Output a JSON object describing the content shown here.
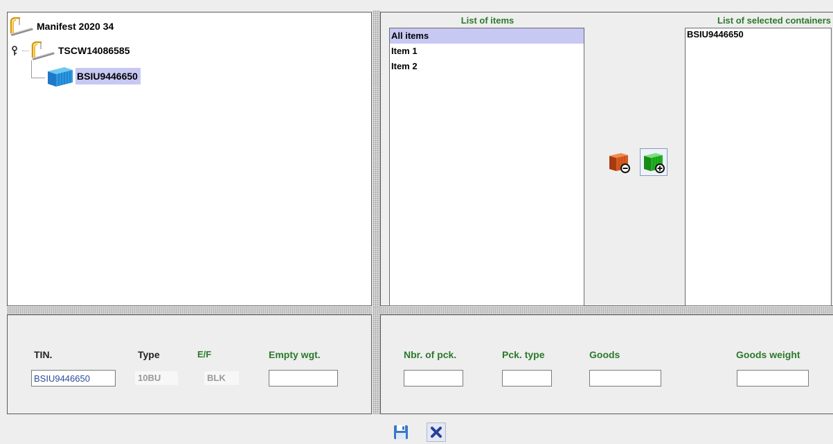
{
  "tree": {
    "root": {
      "label": "Manifest 2020 34",
      "icon": "crane-ship-icon"
    },
    "child": {
      "label": "TSCW14086585",
      "icon": "crane-ship-icon",
      "expander": "key-icon"
    },
    "leaf": {
      "label": "BSIU9446650",
      "icon": "container-blue-icon"
    }
  },
  "items_list": {
    "title": "List of items",
    "items": [
      "All items",
      "Item 1",
      "Item 2"
    ],
    "selected": "All items"
  },
  "containers_list": {
    "title": "List of selected containers",
    "items": [
      "BSIU9446650"
    ]
  },
  "transfer": {
    "remove_icon": "container-remove-icon",
    "add_icon": "container-add-icon"
  },
  "container_form": {
    "tin_label": "TIN.",
    "tin_value": "BSIU9446650",
    "type_label": "Type",
    "type_value": "10BU",
    "ef_label": "E/F",
    "ef_value": "BLK",
    "empty_wgt_label": "Empty wgt.",
    "empty_wgt_value": ""
  },
  "item_form": {
    "nbr_pck_label": "Nbr. of pck.",
    "nbr_pck_value": "",
    "pck_type_label": "Pck. type",
    "pck_type_value": "",
    "goods_label": "Goods",
    "goods_value": "",
    "goods_weight_label": "Goods weight",
    "goods_weight_value": ""
  },
  "footer": {
    "save_icon": "save-icon",
    "close_icon": "close-icon"
  },
  "colors": {
    "green_label": "#2a7a2a",
    "selection": "#c8c8f4",
    "accent_blue": "#2a6ad8"
  }
}
